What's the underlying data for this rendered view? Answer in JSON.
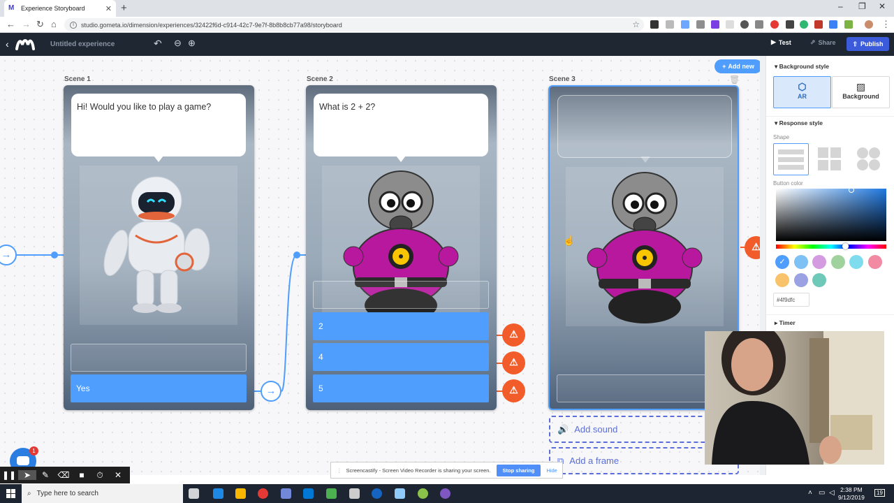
{
  "browser": {
    "tab_title": "Experience Storyboard",
    "url": "studio.gometa.io/dimension/experiences/32422f6d-c914-42c7-9e7f-8b8b8cb77a98/storyboard",
    "win_minimize": "–",
    "win_maximize": "❐",
    "win_close": "✕"
  },
  "app": {
    "experience_title": "Untitled experience",
    "test_label": "Test",
    "share_label": "Share",
    "publish_label": "Publish",
    "add_new_label": "Add new"
  },
  "scenes": [
    {
      "label": "Scene 1",
      "speech": "Hi! Would you like to play a game?",
      "character": "robot",
      "responses": [
        "Yes"
      ]
    },
    {
      "label": "Scene 2",
      "speech": "What is 2 + 2?",
      "character": "gas-mask-alien",
      "responses": [
        "2",
        "4",
        "5"
      ]
    },
    {
      "label": "Scene 3",
      "speech": "",
      "character": "gas-mask-alien",
      "responses": []
    }
  ],
  "scene3_actions": {
    "add_sound": "Add sound",
    "add_frame": "Add a frame"
  },
  "panel": {
    "background_style": {
      "heading": "Background style",
      "options": [
        {
          "label": "AR",
          "active": true
        },
        {
          "label": "Background",
          "active": false
        }
      ]
    },
    "response_style": {
      "heading": "Response style",
      "shape_label": "Shape",
      "button_color_label": "Button color",
      "selected_color": "#4f9dfc",
      "hex_value": "#4f9dfc",
      "swatches": [
        "#4f9dfc",
        "#7ec1f4",
        "#d49be0",
        "#9fd29d",
        "#7fdcef",
        "#f28aa3",
        "#f9c36b",
        "#9aa2e3",
        "#6fc9b8"
      ]
    },
    "timer_heading": "Timer"
  },
  "screencastify": {
    "sharing_text": "Screencastify - Screen Video Recorder is sharing your screen.",
    "stop_label": "Stop sharing",
    "hide_label": "Hide",
    "notification_count": "1"
  },
  "taskbar": {
    "search_placeholder": "Type here to search",
    "time": "2:38 PM",
    "date": "9/12/2019",
    "notifications": "19"
  }
}
